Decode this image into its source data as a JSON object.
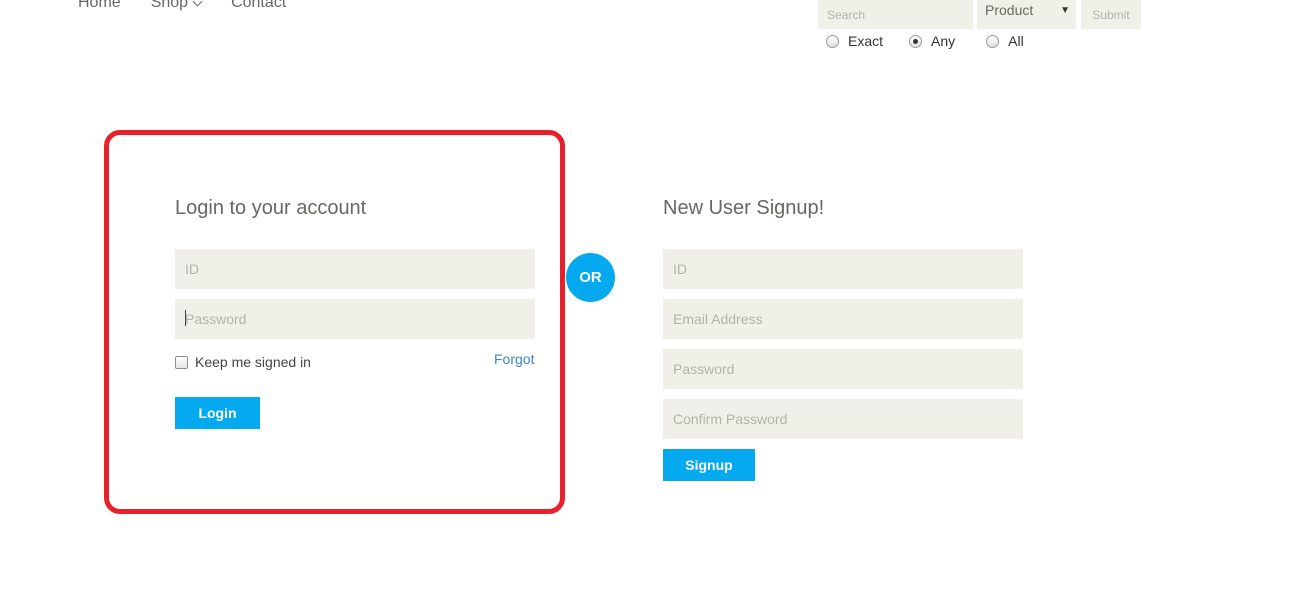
{
  "nav": {
    "home": "Home",
    "shop": "Shop",
    "contact": "Contact"
  },
  "search": {
    "placeholder": "Search",
    "category_selected": "Product",
    "submit": "Submit",
    "match_options": [
      "Exact",
      "Any",
      "All"
    ],
    "match_selected": "Any"
  },
  "login": {
    "title": "Login to your account",
    "id_placeholder": "ID",
    "password_placeholder": "Password",
    "keep_signed_in": "Keep me signed in",
    "forgot": "Forgot",
    "button": "Login"
  },
  "or_label": "OR",
  "signup": {
    "title": "New User Signup!",
    "id_placeholder": "ID",
    "email_placeholder": "Email Address",
    "password_placeholder": "Password",
    "confirm_placeholder": "Confirm Password",
    "button": "Signup"
  },
  "colors": {
    "accent": "#04a9ef",
    "highlight": "#e8202b",
    "field_bg": "#f0f0e9"
  }
}
